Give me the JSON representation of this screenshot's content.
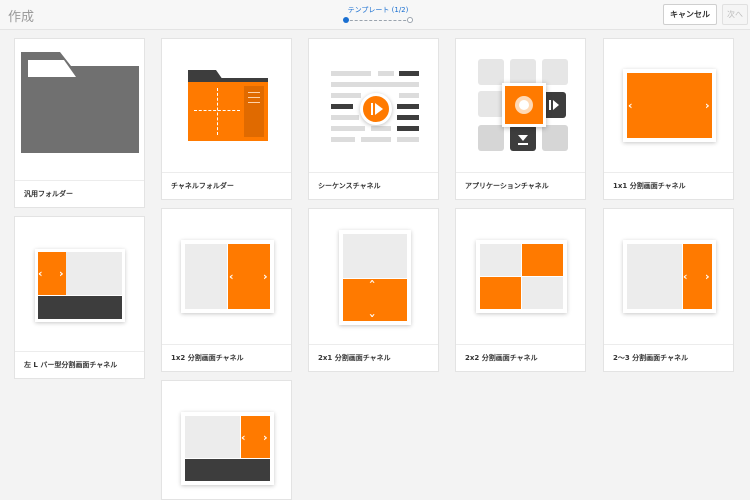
{
  "header": {
    "title": "作成",
    "step_label": "テンプレート (1/2)",
    "cancel_label": "キャンセル",
    "next_label": "次へ"
  },
  "colors": {
    "accent": "#ff7a00",
    "dark": "#3d3d3d",
    "light": "#ececec",
    "step": "#1a6fd1"
  },
  "templates": [
    {
      "label": "汎用フォルダー",
      "icon": "folder-icon"
    },
    {
      "label": "チャネルフォルダー",
      "icon": "channel-folder-icon"
    },
    {
      "label": "シーケンスチャネル",
      "icon": "sequence-icon"
    },
    {
      "label": "アプリケーションチャネル",
      "icon": "app-grid-icon"
    },
    {
      "label": "1x1 分割画面チャネル",
      "icon": "split-1x1-icon"
    },
    {
      "label": "左 L バー型分割画面チャネル",
      "icon": "l-bar-icon"
    },
    {
      "label": "1x2 分割画面チャネル",
      "icon": "split-1x2-icon"
    },
    {
      "label": "2x1 分割画面チャネル",
      "icon": "split-2x1-icon"
    },
    {
      "label": "2x2 分割画面チャネル",
      "icon": "split-2x2-icon"
    },
    {
      "label": "2～3 分割画面チャネル",
      "icon": "split-2-3-icon"
    },
    {
      "label": "",
      "icon": "l-bar-right-icon"
    }
  ]
}
